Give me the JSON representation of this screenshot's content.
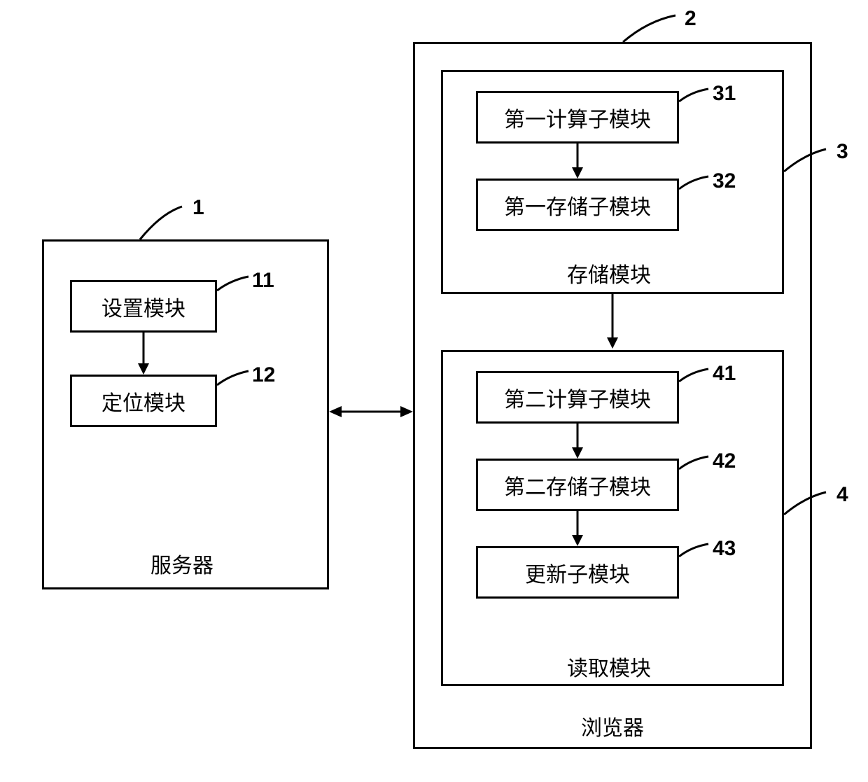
{
  "server": {
    "title": "服务器",
    "num": "1",
    "block11": {
      "label": "设置模块",
      "num": "11"
    },
    "block12": {
      "label": "定位模块",
      "num": "12"
    }
  },
  "browser": {
    "title": "浏览器",
    "num": "2",
    "storage": {
      "title": "存储模块",
      "num": "3",
      "block31": {
        "label": "第一计算子模块",
        "num": "31"
      },
      "block32": {
        "label": "第一存储子模块",
        "num": "32"
      }
    },
    "read": {
      "title": "读取模块",
      "num": "4",
      "block41": {
        "label": "第二计算子模块",
        "num": "41"
      },
      "block42": {
        "label": "第二存储子模块",
        "num": "42"
      },
      "block43": {
        "label": "更新子模块",
        "num": "43"
      }
    }
  }
}
